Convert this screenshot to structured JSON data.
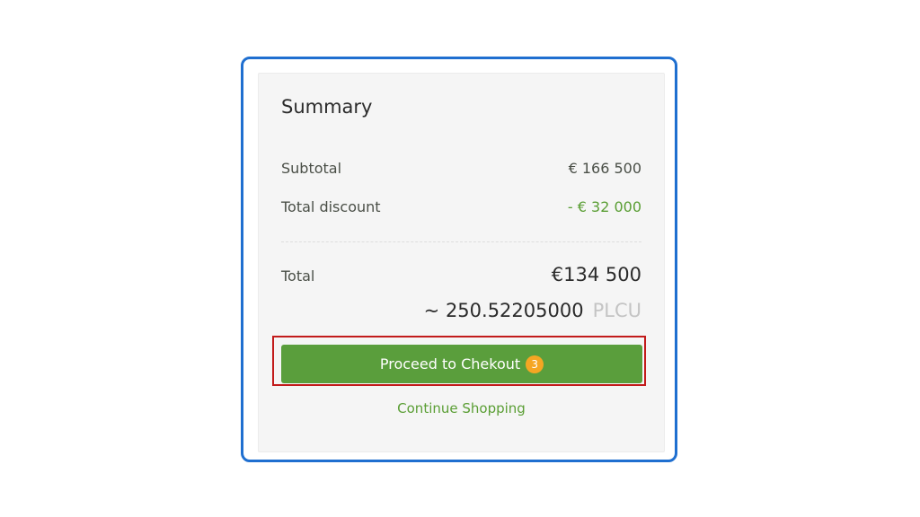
{
  "summary": {
    "title": "Summary",
    "subtotal_label": "Subtotal",
    "subtotal_value": "€ 166 500",
    "discount_label": "Total discount",
    "discount_value": "-  € 32 000",
    "total_label": "Total",
    "total_value": "€134 500",
    "crypto_amount": "~ 250.52205000",
    "crypto_currency": "PLCU"
  },
  "actions": {
    "checkout_label": "Proceed to Chekout",
    "checkout_badge": "3",
    "continue_label": "Continue Shopping"
  },
  "colors": {
    "accent_green": "#5a9e3c",
    "badge_orange": "#f5a623",
    "frame_blue": "#1f6fd0",
    "highlight_red": "#c21b1b"
  }
}
